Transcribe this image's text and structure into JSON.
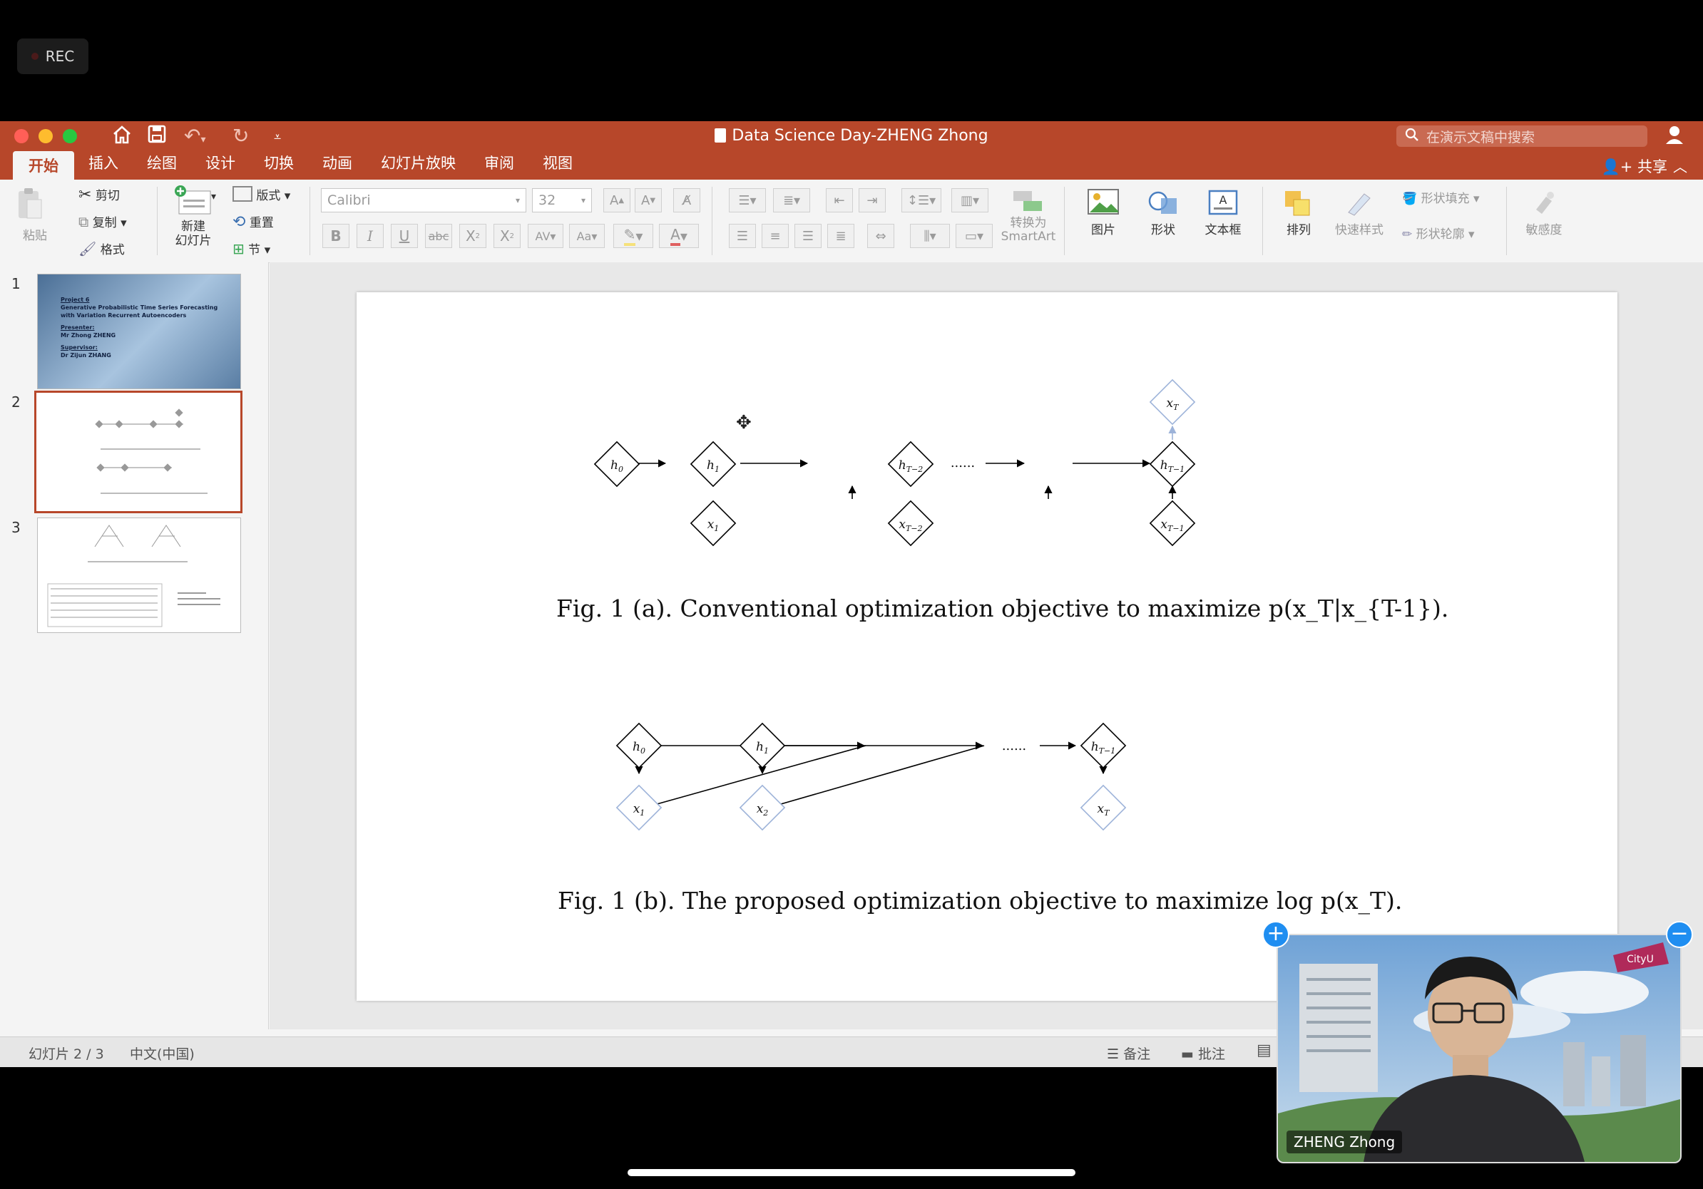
{
  "recording": {
    "label": "REC"
  },
  "window": {
    "title": "Data Science Day-ZHENG Zhong",
    "search_placeholder": "在演示文稿中搜索",
    "share_label": "共享",
    "tabs": [
      {
        "label": "开始",
        "active": true
      },
      {
        "label": "插入"
      },
      {
        "label": "绘图"
      },
      {
        "label": "设计"
      },
      {
        "label": "切换"
      },
      {
        "label": "动画"
      },
      {
        "label": "幻灯片放映"
      },
      {
        "label": "审阅"
      },
      {
        "label": "视图"
      }
    ]
  },
  "ribbon": {
    "paste": "粘贴",
    "cut": "剪切",
    "copy": "复制",
    "format": "格式",
    "new_slide": "新建\n幻灯片",
    "layout": "版式",
    "reset": "重置",
    "section": "节",
    "font_name": "Calibri",
    "font_size": "32",
    "convert_smartart": "转换为\nSmartArt",
    "picture": "图片",
    "shapes": "形状",
    "textbox": "文本框",
    "arrange": "排列",
    "quick_styles": "快速样式",
    "shape_fill": "形状填充",
    "shape_outline": "形状轮廓",
    "sensitivity": "敏感度"
  },
  "sidebar": {
    "slides": [
      {
        "number": "1"
      },
      {
        "number": "2",
        "selected": true
      },
      {
        "number": "3"
      }
    ],
    "slide1_text": {
      "project": "Project 6",
      "title": "Generative Probabilistic Time Series Forecasting with Variation Recurrent Autoencoders",
      "presenter_label": "Presenter:",
      "presenter": "Mr Zhong ZHENG",
      "supervisor_label": "Supervisor:",
      "supervisor": "Dr Zijun ZHANG"
    }
  },
  "slide": {
    "fig_a_caption": "Fig. 1 (a). Conventional optimization objective to maximize p(x_T|x_{T-1}).",
    "fig_b_caption": "Fig. 1 (b). The proposed optimization objective to maximize log p(x_T).",
    "ellipsis": "......"
  },
  "status_bar": {
    "slide_counter": "幻灯片 2 / 3",
    "language": "中文(中国)",
    "notes": "备注",
    "comments": "批注"
  },
  "video": {
    "name": "ZHENG Zhong"
  },
  "colors": {
    "accent": "#b7472a",
    "node_blue": "#9db3d9"
  }
}
